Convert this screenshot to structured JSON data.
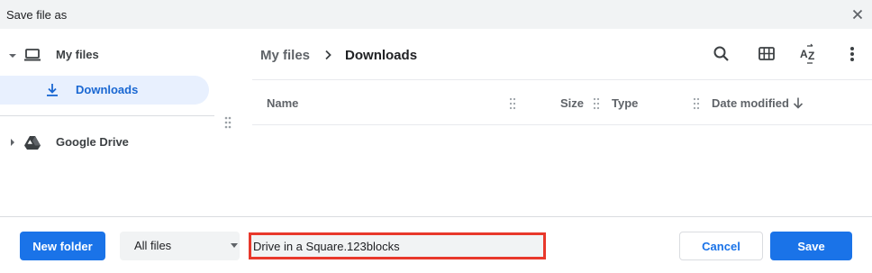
{
  "window": {
    "title": "Save file as",
    "close_icon": "close-icon"
  },
  "sidebar": {
    "items": [
      {
        "label": "My files",
        "icon": "laptop-icon",
        "expanded": true
      },
      {
        "label": "Downloads",
        "icon": "download-icon",
        "selected": true
      },
      {
        "label": "Google Drive",
        "icon": "google-drive-icon",
        "expanded": false
      }
    ]
  },
  "breadcrumb": {
    "root": "My files",
    "current": "Downloads"
  },
  "toolbar": {
    "icons": [
      "search-icon",
      "grid-view-icon",
      "sort-az-icon",
      "more-vertical-icon"
    ]
  },
  "table": {
    "columns": [
      "Name",
      "Size",
      "Type",
      "Date modified"
    ],
    "sort_direction": "descending",
    "rows": []
  },
  "footer": {
    "new_folder_label": "New folder",
    "file_type_value": "All files",
    "filename_value": "Drive in a Square.123blocks",
    "cancel_label": "Cancel",
    "save_label": "Save"
  },
  "colors": {
    "accent": "#1a73e8",
    "selected_bg": "#e8f0fe",
    "highlight_border": "#e8382b",
    "titlebar_bg": "#f1f3f4"
  }
}
